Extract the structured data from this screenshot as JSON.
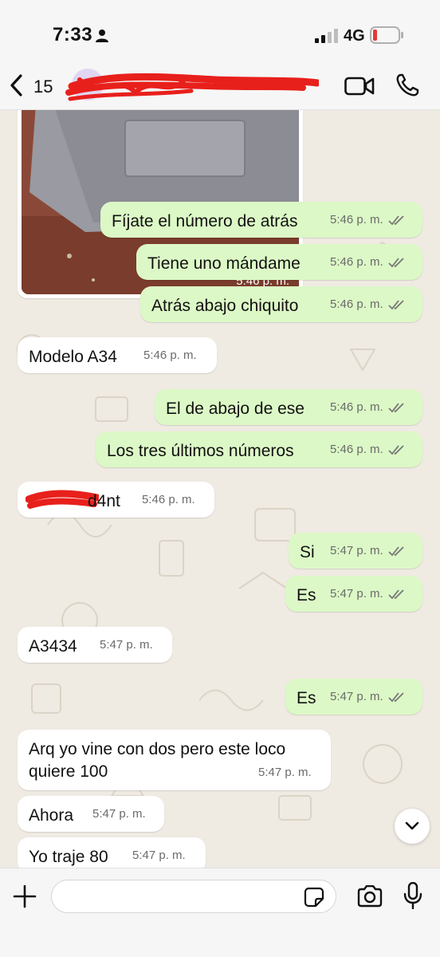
{
  "status_bar": {
    "time": "7:33",
    "network": "4G",
    "icons": [
      "person-icon",
      "signal-icon",
      "battery-low-icon"
    ],
    "battery_color": "#e53935"
  },
  "header": {
    "back_count": "15",
    "contact_name_redacted": true,
    "icons": [
      "back-chevron-icon",
      "video-call-icon",
      "phone-call-icon"
    ]
  },
  "colors": {
    "outgoing_bubble": "#dcf8c6",
    "incoming_bubble": "#ffffff",
    "chat_background": "#efeae2",
    "redaction": "#e8201c"
  },
  "messages": [
    {
      "direction": "in",
      "type": "image",
      "time": "5:46 p. m."
    },
    {
      "direction": "out",
      "text": "Fíjate el número de atrás",
      "time": "5:46 p. m.",
      "read": true
    },
    {
      "direction": "out",
      "text": "Tiene uno mándame",
      "time": "5:46 p. m.",
      "read": true
    },
    {
      "direction": "out",
      "text": "Atrás abajo chiquito",
      "time": "5:46 p. m.",
      "read": true
    },
    {
      "direction": "in",
      "text": "Modelo A34",
      "time": "5:46 p. m."
    },
    {
      "direction": "out",
      "text": "El de abajo de ese",
      "time": "5:46 p. m.",
      "read": true
    },
    {
      "direction": "out",
      "text": "Los tres últimos números",
      "time": "5:46 p. m.",
      "read": true
    },
    {
      "direction": "in",
      "text": "d4nt",
      "time": "5:46 p. m.",
      "partially_redacted": true
    },
    {
      "direction": "out",
      "text": "Si",
      "time": "5:47 p. m.",
      "read": true
    },
    {
      "direction": "out",
      "text": "Es",
      "time": "5:47 p. m.",
      "read": true
    },
    {
      "direction": "in",
      "text": "A3434",
      "time": "5:47 p. m."
    },
    {
      "direction": "out",
      "text": "Es",
      "time": "5:47 p. m.",
      "read": true
    },
    {
      "direction": "in",
      "text": "Arq yo vine con dos pero este loco quiere 100",
      "time": "5:47 p. m."
    },
    {
      "direction": "in",
      "text": "Ahora",
      "time": "5:47 p. m."
    },
    {
      "direction": "in",
      "text": "Yo traje 80",
      "time": "5:47 p. m."
    }
  ],
  "input": {
    "value": "",
    "icons": [
      "plus-icon",
      "sticker-icon",
      "camera-icon",
      "microphone-icon"
    ]
  },
  "scroll_button_icon": "chevron-down-icon"
}
